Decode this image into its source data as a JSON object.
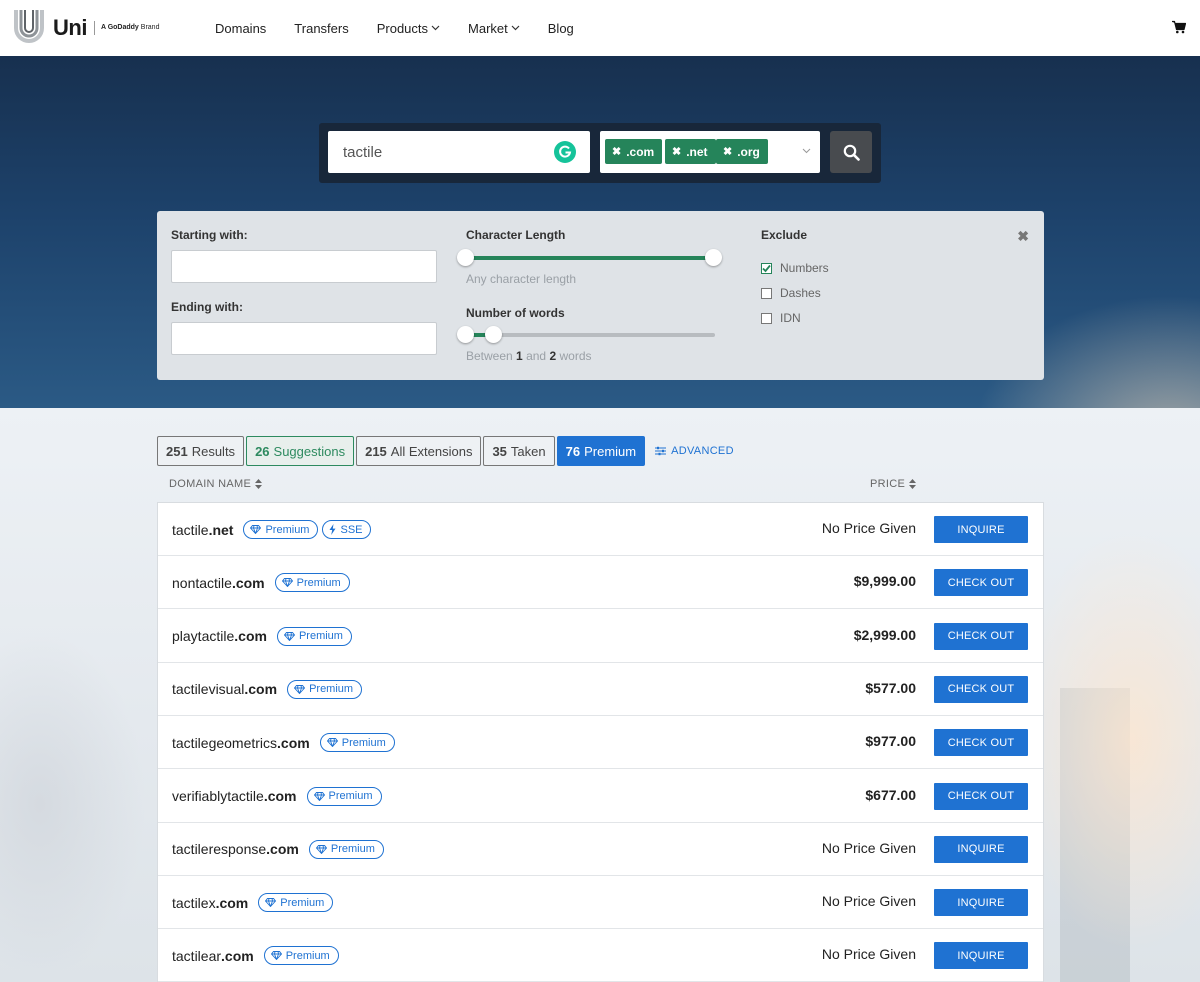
{
  "brand": {
    "name": "Uni",
    "tagline_prefix": "A",
    "tagline_brand": "GoDaddy",
    "tagline_suffix": "Brand"
  },
  "nav": [
    {
      "label": "Domains",
      "has_dropdown": false
    },
    {
      "label": "Transfers",
      "has_dropdown": false
    },
    {
      "label": "Products",
      "has_dropdown": true
    },
    {
      "label": "Market",
      "has_dropdown": true
    },
    {
      "label": "Blog",
      "has_dropdown": false
    }
  ],
  "icons": {
    "cart": "cart-icon",
    "search": "search-icon",
    "grammarly": "grammarly-icon",
    "premium": "diamond-icon",
    "sse": "lightning-icon",
    "advanced": "sliders-icon",
    "close": "close-icon"
  },
  "search": {
    "query": "tactile",
    "tlds": [
      ".com",
      ".net",
      ".org"
    ],
    "tld_remove_glyph": "✖"
  },
  "filters": {
    "starting_label": "Starting with:",
    "starting_value": "",
    "ending_label": "Ending with:",
    "ending_value": "",
    "char_length_label": "Character Length",
    "char_length_help": "Any character length",
    "words_label": "Number of words",
    "words_help_prefix": "Between",
    "words_min": "1",
    "words_help_mid": "and",
    "words_max": "2",
    "words_help_suffix": "words",
    "exclude_label": "Exclude",
    "exclude_options": [
      {
        "label": "Numbers",
        "checked": true
      },
      {
        "label": "Dashes",
        "checked": false
      },
      {
        "label": "IDN",
        "checked": false
      }
    ],
    "close_glyph": "✖"
  },
  "tabs": [
    {
      "count": "251",
      "label": "Results"
    },
    {
      "count": "26",
      "label": "Suggestions"
    },
    {
      "count": "215",
      "label": "All Extensions"
    },
    {
      "count": "35",
      "label": "Taken"
    },
    {
      "count": "76",
      "label": "Premium",
      "active": true
    }
  ],
  "advanced_label": "ADVANCED",
  "columns": {
    "domain": "DOMAIN NAME",
    "price": "PRICE"
  },
  "badges": {
    "premium": "Premium",
    "sse": "SSE"
  },
  "colors": {
    "accent_blue": "#1f72d2",
    "tld_green": "#25845a",
    "suggest_green": "#2d8a5f"
  },
  "results": [
    {
      "sld": "tactile",
      "tld": ".net",
      "sse": true,
      "price": "No Price Given",
      "action": "INQUIRE"
    },
    {
      "sld": "nontactile",
      "tld": ".com",
      "sse": false,
      "price": "$9,999.00",
      "action": "CHECK OUT"
    },
    {
      "sld": "playtactile",
      "tld": ".com",
      "sse": false,
      "price": "$2,999.00",
      "action": "CHECK OUT"
    },
    {
      "sld": "tactilevisual",
      "tld": ".com",
      "sse": false,
      "price": "$577.00",
      "action": "CHECK OUT"
    },
    {
      "sld": "tactilegeometrics",
      "tld": ".com",
      "sse": false,
      "price": "$977.00",
      "action": "CHECK OUT"
    },
    {
      "sld": "verifiablytactile",
      "tld": ".com",
      "sse": false,
      "price": "$677.00",
      "action": "CHECK OUT"
    },
    {
      "sld": "tactileresponse",
      "tld": ".com",
      "sse": false,
      "price": "No Price Given",
      "action": "INQUIRE"
    },
    {
      "sld": "tactilex",
      "tld": ".com",
      "sse": false,
      "price": "No Price Given",
      "action": "INQUIRE"
    },
    {
      "sld": "tactilear",
      "tld": ".com",
      "sse": false,
      "price": "No Price Given",
      "action": "INQUIRE"
    }
  ]
}
